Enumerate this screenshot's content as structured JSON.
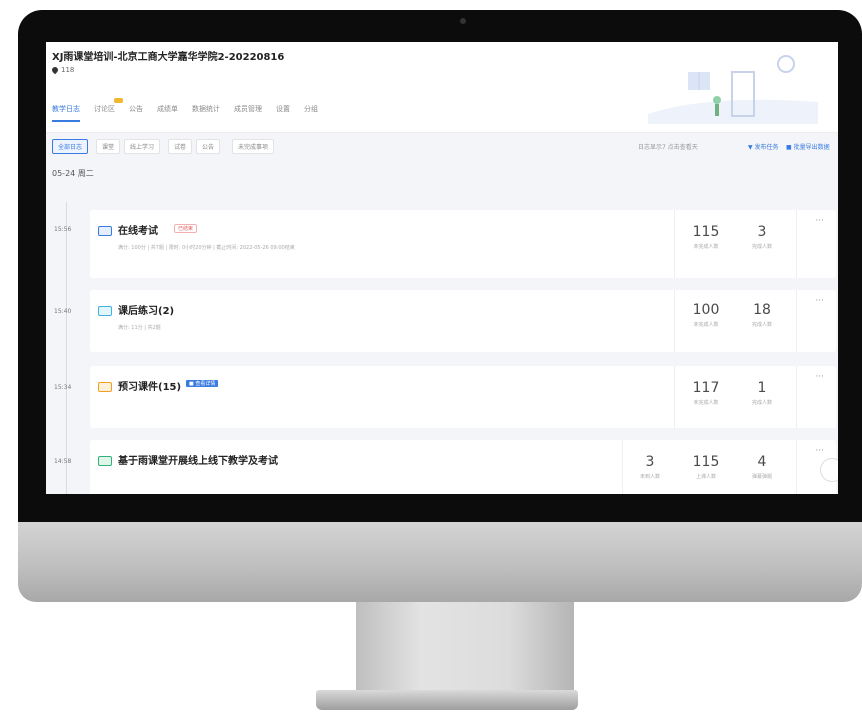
{
  "header": {
    "course_title": "XJ雨课堂培训-北京工商大学嘉华学院2-20220816",
    "member_count": "118",
    "tabs": [
      "教学日志",
      "讨论区",
      "公告",
      "成绩单",
      "数据统计",
      "成员管理",
      "设置",
      "分组"
    ]
  },
  "filters": {
    "buttons": [
      "全部日志",
      "课堂",
      "线上学习",
      "试卷",
      "公告",
      "未完成事项"
    ],
    "right_text": "日志显示7 点击查看天",
    "new_task": "发布任务",
    "export": "批量导出数据"
  },
  "date_label": "05-24 周二",
  "activities": [
    {
      "time": "15:56",
      "title": "在线考试",
      "flag": "已结束",
      "subtitle": "满分: 100分 | 共7题 | 限时: 0小时20分钟 | 截止时间: 2022-05-26 09:00结束",
      "stats": [
        {
          "value": "115",
          "label": "未完成人数"
        },
        {
          "value": "3",
          "label": "完成人数"
        }
      ],
      "tag_color": "#3a7be0",
      "tag_bg": "#e4eeff"
    },
    {
      "time": "15:40",
      "title": "课后练习(2)",
      "subtitle": "满分: 11分 | 共2题",
      "stats": [
        {
          "value": "100",
          "label": "未完成人数"
        },
        {
          "value": "18",
          "label": "完成人数"
        }
      ],
      "tag_color": "#3fb3e0",
      "tag_bg": "#e2f5fc"
    },
    {
      "time": "15:34",
      "title": "预习课件(15)",
      "badge": "■ 查看详情",
      "stats": [
        {
          "value": "117",
          "label": "未完成人数"
        },
        {
          "value": "1",
          "label": "完成人数"
        }
      ],
      "tag_color": "#f0a020",
      "tag_bg": "#fff1d9"
    },
    {
      "time": "14:58",
      "title": "基于雨课堂开展线上线下教学及考试",
      "stats": [
        {
          "value": "3",
          "label": "未到人数"
        },
        {
          "value": "115",
          "label": "上课人数"
        },
        {
          "value": "4",
          "label": "弹幕弹题"
        }
      ],
      "tag_color": "#2fb37a",
      "tag_bg": "#dff5ea"
    }
  ],
  "icons": {
    "location": "location-pin-icon",
    "more": "more-dots-icon",
    "send": "send-icon",
    "export": "export-icon"
  },
  "colors": {
    "accent": "#3a7be0",
    "background": "#f4f5f8"
  }
}
